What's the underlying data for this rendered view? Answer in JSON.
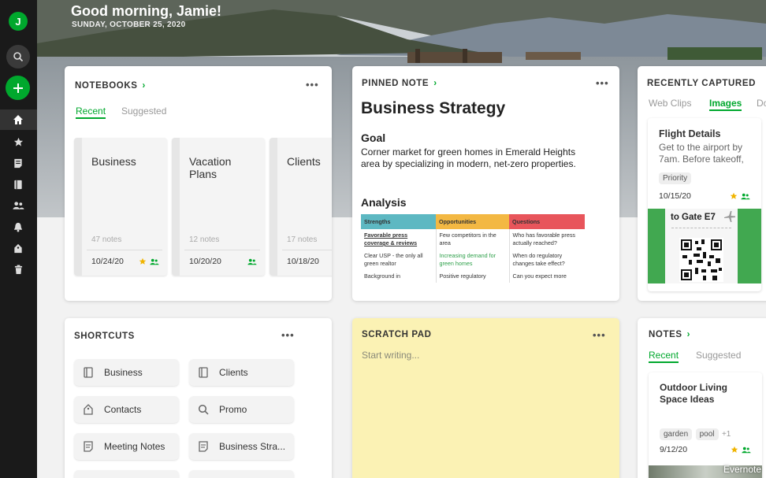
{
  "header": {
    "greeting": "Good morning, Jamie!",
    "date": "SUNDAY, OCTOBER 25, 2020"
  },
  "sidebar": {
    "avatar_letter": "J",
    "icons": [
      "search-icon",
      "new-note-icon",
      "home-icon",
      "star-icon",
      "notes-icon",
      "notebooks-icon",
      "shared-icon",
      "reminder-icon",
      "tags-icon",
      "trash-icon"
    ]
  },
  "notebooks": {
    "title": "NOTEBOOKS",
    "more": "•••",
    "tabs": [
      "Recent",
      "Suggested"
    ],
    "items": [
      {
        "name": "Business",
        "count": "47 notes",
        "date": "10/24/20"
      },
      {
        "name": "Vacation Plans",
        "count": "12 notes",
        "date": "10/20/20"
      },
      {
        "name": "Clients",
        "count": "17 notes",
        "date": "10/18/20"
      }
    ]
  },
  "pinned": {
    "title": "PINNED NOTE",
    "more": "•••",
    "note_title": "Business Strategy",
    "goal_heading": "Goal",
    "goal_text": "Corner market for green homes in Emerald Heights area by specializing in modern, net-zero properties.",
    "analysis_heading": "Analysis",
    "table": {
      "headers": [
        "Strengths",
        "Opportunities",
        "Questions"
      ],
      "rows": [
        [
          "Favorable press coverage & reviews",
          "Few competitors in the area",
          "Who has favorable press actually reached?"
        ],
        [
          "Clear USP - the only all green realtor",
          "Increasing demand for green homes",
          "When do regulatory changes take effect?"
        ],
        [
          "Background in",
          "Positive regulatory",
          "Can you expect more"
        ]
      ]
    }
  },
  "recent": {
    "title": "RECENTLY CAPTURED",
    "tabs": [
      "Web Clips",
      "Images",
      "Do"
    ],
    "card_title": "Flight Details",
    "card_text": "Get to the airport by 7am. Before takeoff,",
    "tag": "Priority",
    "date": "10/15/20",
    "ticket_text": "to Gate E7"
  },
  "shortcuts": {
    "title": "SHORTCUTS",
    "more": "•••",
    "items": [
      "Business",
      "Clients",
      "Contacts",
      "Promo",
      "Meeting Notes",
      "Business Stra..."
    ]
  },
  "scratch": {
    "title": "SCRATCH PAD",
    "more": "•••",
    "placeholder": "Start writing..."
  },
  "notes": {
    "title": "NOTES",
    "tabs": [
      "Recent",
      "Suggested"
    ],
    "card_title": "Outdoor Living Space Ideas",
    "tags": [
      "garden",
      "pool",
      "+1"
    ],
    "date": "9/12/20"
  },
  "watermark": "Evernote",
  "colors": {
    "accent": "#00a82d",
    "sidebar": "#1a1a1a",
    "scratch": "#fbf2b4",
    "strengths": "#5db8c2",
    "opportunities": "#f3b843",
    "questions": "#e8555b"
  }
}
